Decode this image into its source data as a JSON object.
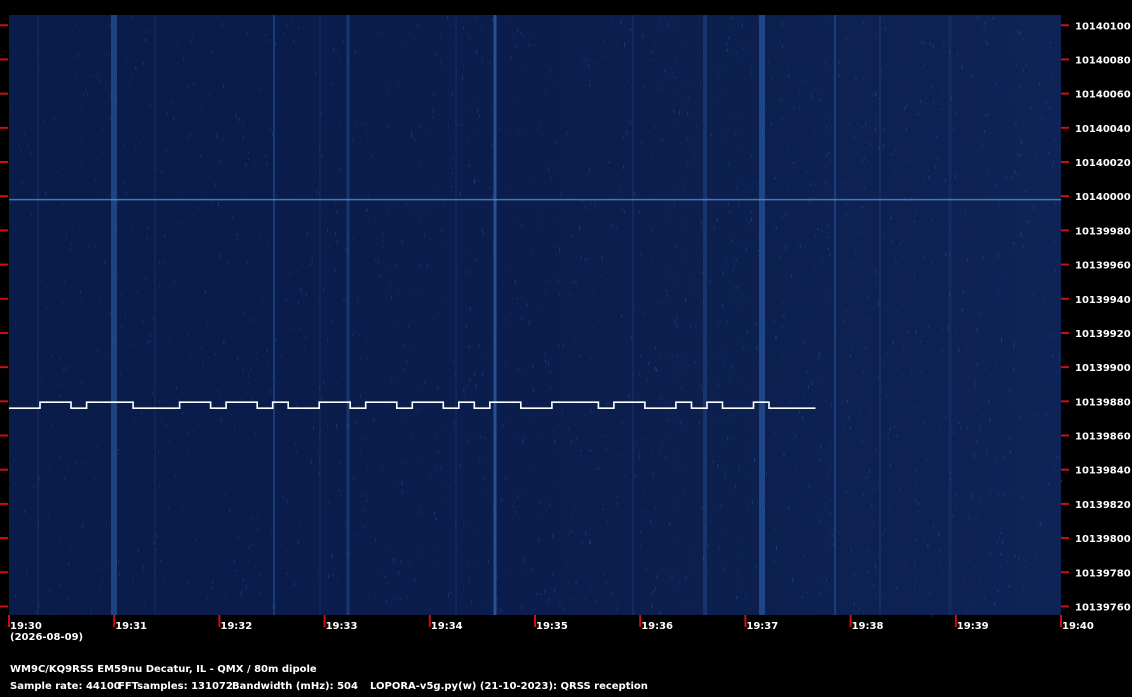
{
  "chart_data": {
    "type": "heatmap",
    "x": [
      "19:30",
      "19:31",
      "19:32",
      "19:33",
      "19:34",
      "19:35",
      "19:36",
      "19:37",
      "19:38",
      "19:39",
      "19:40"
    ],
    "date_label": "(2026-08-09)",
    "y": [
      "10140100",
      "10140080",
      "10140060",
      "10140040",
      "10140020",
      "10140000",
      "10139980",
      "10139960",
      "10139940",
      "10139920",
      "10139900",
      "10139880",
      "10139860",
      "10139840",
      "10139820",
      "10139800",
      "10139780",
      "10139760"
    ],
    "ylim": [
      10139755,
      10140106
    ],
    "xlim": [
      "19:30",
      "19:40"
    ],
    "signal_frequency": 10139876,
    "signal_start": "19:30",
    "signal_end": "19:37:40",
    "carrier_frequency": 10139998,
    "colors": {
      "background": "#0a1a45",
      "trace": "#ffffff",
      "tick": "#cc1010",
      "noise": "#1e4a8c"
    }
  },
  "footer": {
    "station": "WM9C/KQ9RSS EM59nu Decatur, IL - QMX / 80m dipole",
    "sample_rate": "Sample rate: 44100",
    "fft_samples": "FFTsamples: 131072",
    "bandwidth": "Bandwidth (mHz): 504",
    "software": "LOPORA-v5g.py(w) (21-10-2023): QRSS reception"
  }
}
